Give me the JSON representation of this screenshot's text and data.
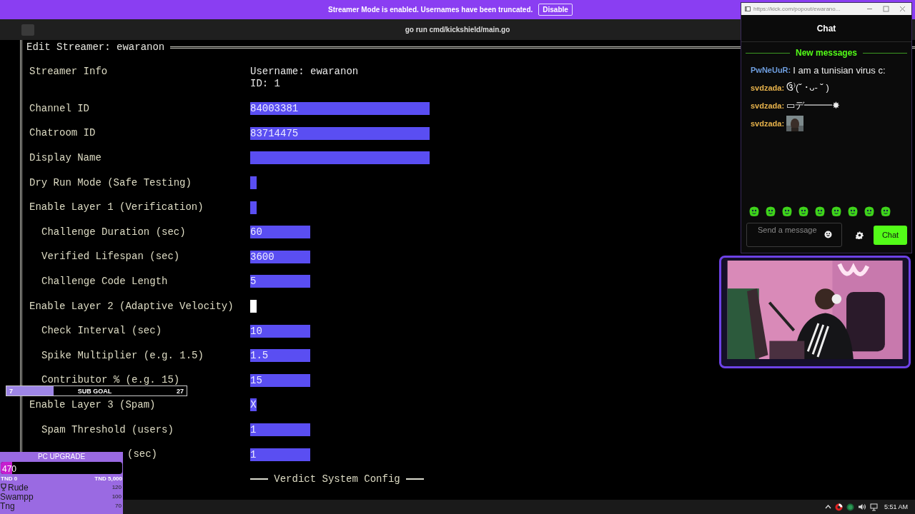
{
  "banner": {
    "text": "Streamer Mode is enabled. Usernames have been truncated.",
    "button": "Disable"
  },
  "terminal": {
    "title": "go run cmd/kickshield/main.go",
    "form": {
      "title": "Edit Streamer: ewaranon",
      "info": {
        "label": "Streamer Info",
        "lines": [
          "Username: ewaranon",
          "ID: 1"
        ]
      },
      "rows": [
        {
          "label": "Channel ID",
          "kind": "text",
          "value": "84003381"
        },
        {
          "label": "Chatroom ID",
          "kind": "text",
          "value": "83714475"
        },
        {
          "label": "Display Name",
          "kind": "text"
        },
        {
          "label": "Dry Run Mode (Safe Testing)",
          "kind": "toggle",
          "focused": false
        },
        {
          "label": "Enable Layer 1 (Verification)",
          "kind": "toggle",
          "focused": false,
          "children": [
            {
              "label": "Challenge Duration (sec)",
              "kind": "number",
              "value": "60"
            },
            {
              "label": "Verified Lifespan (sec)",
              "kind": "number",
              "value": "3600"
            },
            {
              "label": "Challenge Code Length",
              "kind": "number",
              "value": "5"
            }
          ]
        },
        {
          "label": "Enable Layer 2 (Adaptive Velocity)",
          "kind": "toggle",
          "focused": true,
          "children": [
            {
              "label": "Check Interval (sec)",
              "kind": "number",
              "value": "10"
            },
            {
              "label": "Spike Multiplier (e.g. 1.5)",
              "kind": "number",
              "value": "1.5"
            },
            {
              "label": "Contributor % (e.g. 15)",
              "kind": "number",
              "value": "15"
            }
          ]
        },
        {
          "label": "Enable Layer 3 (Spam)",
          "kind": "toggle",
          "focused": false,
          "value": "X",
          "children": [
            {
              "label": "Spam Threshold (users)",
              "kind": "number",
              "value": "1"
            },
            {
              "label": "(sec)",
              "kind": "number",
              "value": "1",
              "partly_hidden": true
            }
          ]
        }
      ],
      "section": "Verdict System Config"
    }
  },
  "chat": {
    "url": "https://kick.com/popout/ewarano...",
    "title": "Chat",
    "divider": "New messages",
    "messages": [
      {
        "user": "PwNeUuR:",
        "color": "#6f9fe0",
        "kind": "text",
        "text": "I am a tunisian virus c:"
      },
      {
        "user": "svdzada:",
        "color": "#e9b44c",
        "kind": "text",
        "text": "ઉ⁾(˘ ･ᴗ- ˘ )"
      },
      {
        "user": "svdzada:",
        "color": "#e9b44c",
        "kind": "text",
        "text": "▭デ━━━✸"
      },
      {
        "user": "svdzada:",
        "color": "#e9b44c"
      }
    ],
    "input": {
      "placeholder": "Send a message"
    },
    "send": "Chat"
  },
  "sub_goal": {
    "current": "7",
    "title": "SUB GOAL",
    "target": "27",
    "level": 0.26
  },
  "donation_goal": {
    "title": "PC UPGRADE",
    "amount": "470",
    "level": 0.094,
    "min": "TND 0",
    "max": "TND 5,000",
    "leaders": [
      {
        "name": "Rude",
        "amount": "120",
        "top": true
      },
      {
        "name": "Swampp",
        "amount": "100",
        "top": false
      },
      {
        "name": "Tng",
        "amount": "70",
        "top": false
      }
    ]
  },
  "taskbar": {
    "time": "5:51 AM"
  }
}
